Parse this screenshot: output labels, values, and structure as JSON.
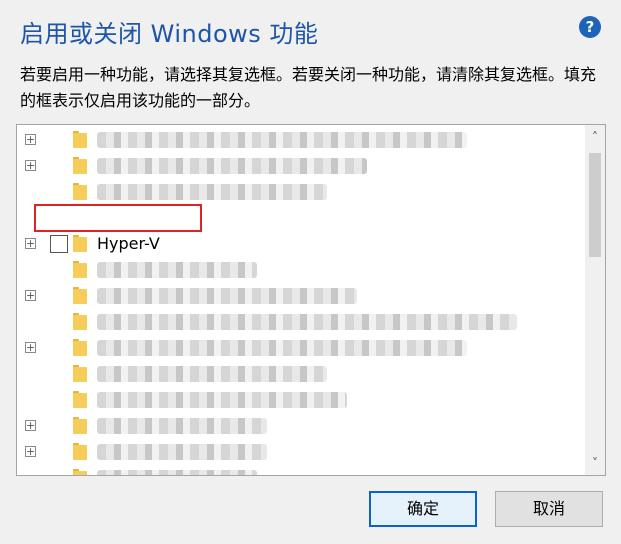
{
  "dialog": {
    "title": "启用或关闭 Windows 功能",
    "help_icon": "?",
    "description": "若要启用一种功能，请选择其复选框。若要关闭一种功能，请清除其复选框。填充的框表示仅启用该功能的一部分。"
  },
  "features": [
    {
      "label": "",
      "expandable": true,
      "checked": false
    },
    {
      "label": "",
      "expandable": true,
      "checked": false
    },
    {
      "label": "",
      "expandable": false,
      "checked": false
    },
    {
      "label": "Hyper-V",
      "expandable": true,
      "checked": false,
      "highlighted": true
    },
    {
      "label": "",
      "expandable": false,
      "checked": false
    },
    {
      "label": "",
      "expandable": true,
      "checked": false
    },
    {
      "label": "",
      "expandable": false,
      "checked": false
    },
    {
      "label": "",
      "expandable": true,
      "checked": false
    },
    {
      "label": "",
      "expandable": false,
      "checked": false
    },
    {
      "label": "",
      "expandable": false,
      "checked": false
    },
    {
      "label": "",
      "expandable": true,
      "checked": false
    },
    {
      "label": "",
      "expandable": true,
      "checked": false
    },
    {
      "label": "",
      "expandable": false,
      "checked": false
    }
  ],
  "scrollbar": {
    "up_icon": "chevron-up-icon",
    "down_icon": "chevron-down-icon"
  },
  "buttons": {
    "ok_label": "确定",
    "cancel_label": "取消"
  },
  "colors": {
    "title": "#1e55a8",
    "highlight": "#e02424",
    "ok_border": "#0a64c8",
    "help": "#1d63b8"
  }
}
